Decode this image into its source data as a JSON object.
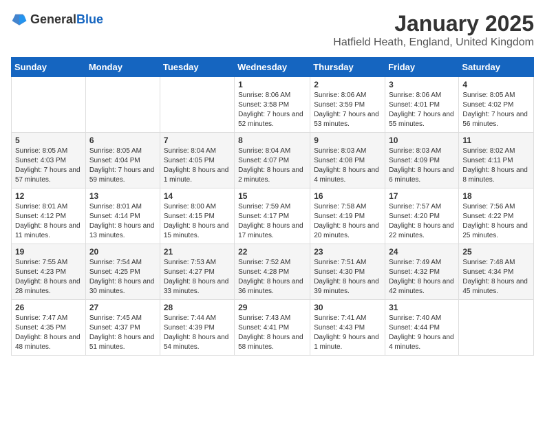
{
  "header": {
    "logo_general": "General",
    "logo_blue": "Blue",
    "title": "January 2025",
    "subtitle": "Hatfield Heath, England, United Kingdom"
  },
  "weekdays": [
    "Sunday",
    "Monday",
    "Tuesday",
    "Wednesday",
    "Thursday",
    "Friday",
    "Saturday"
  ],
  "weeks": [
    [
      {
        "day": "",
        "info": ""
      },
      {
        "day": "",
        "info": ""
      },
      {
        "day": "",
        "info": ""
      },
      {
        "day": "1",
        "info": "Sunrise: 8:06 AM\nSunset: 3:58 PM\nDaylight: 7 hours and 52 minutes."
      },
      {
        "day": "2",
        "info": "Sunrise: 8:06 AM\nSunset: 3:59 PM\nDaylight: 7 hours and 53 minutes."
      },
      {
        "day": "3",
        "info": "Sunrise: 8:06 AM\nSunset: 4:01 PM\nDaylight: 7 hours and 55 minutes."
      },
      {
        "day": "4",
        "info": "Sunrise: 8:05 AM\nSunset: 4:02 PM\nDaylight: 7 hours and 56 minutes."
      }
    ],
    [
      {
        "day": "5",
        "info": "Sunrise: 8:05 AM\nSunset: 4:03 PM\nDaylight: 7 hours and 57 minutes."
      },
      {
        "day": "6",
        "info": "Sunrise: 8:05 AM\nSunset: 4:04 PM\nDaylight: 7 hours and 59 minutes."
      },
      {
        "day": "7",
        "info": "Sunrise: 8:04 AM\nSunset: 4:05 PM\nDaylight: 8 hours and 1 minute."
      },
      {
        "day": "8",
        "info": "Sunrise: 8:04 AM\nSunset: 4:07 PM\nDaylight: 8 hours and 2 minutes."
      },
      {
        "day": "9",
        "info": "Sunrise: 8:03 AM\nSunset: 4:08 PM\nDaylight: 8 hours and 4 minutes."
      },
      {
        "day": "10",
        "info": "Sunrise: 8:03 AM\nSunset: 4:09 PM\nDaylight: 8 hours and 6 minutes."
      },
      {
        "day": "11",
        "info": "Sunrise: 8:02 AM\nSunset: 4:11 PM\nDaylight: 8 hours and 8 minutes."
      }
    ],
    [
      {
        "day": "12",
        "info": "Sunrise: 8:01 AM\nSunset: 4:12 PM\nDaylight: 8 hours and 11 minutes."
      },
      {
        "day": "13",
        "info": "Sunrise: 8:01 AM\nSunset: 4:14 PM\nDaylight: 8 hours and 13 minutes."
      },
      {
        "day": "14",
        "info": "Sunrise: 8:00 AM\nSunset: 4:15 PM\nDaylight: 8 hours and 15 minutes."
      },
      {
        "day": "15",
        "info": "Sunrise: 7:59 AM\nSunset: 4:17 PM\nDaylight: 8 hours and 17 minutes."
      },
      {
        "day": "16",
        "info": "Sunrise: 7:58 AM\nSunset: 4:19 PM\nDaylight: 8 hours and 20 minutes."
      },
      {
        "day": "17",
        "info": "Sunrise: 7:57 AM\nSunset: 4:20 PM\nDaylight: 8 hours and 22 minutes."
      },
      {
        "day": "18",
        "info": "Sunrise: 7:56 AM\nSunset: 4:22 PM\nDaylight: 8 hours and 25 minutes."
      }
    ],
    [
      {
        "day": "19",
        "info": "Sunrise: 7:55 AM\nSunset: 4:23 PM\nDaylight: 8 hours and 28 minutes."
      },
      {
        "day": "20",
        "info": "Sunrise: 7:54 AM\nSunset: 4:25 PM\nDaylight: 8 hours and 30 minutes."
      },
      {
        "day": "21",
        "info": "Sunrise: 7:53 AM\nSunset: 4:27 PM\nDaylight: 8 hours and 33 minutes."
      },
      {
        "day": "22",
        "info": "Sunrise: 7:52 AM\nSunset: 4:28 PM\nDaylight: 8 hours and 36 minutes."
      },
      {
        "day": "23",
        "info": "Sunrise: 7:51 AM\nSunset: 4:30 PM\nDaylight: 8 hours and 39 minutes."
      },
      {
        "day": "24",
        "info": "Sunrise: 7:49 AM\nSunset: 4:32 PM\nDaylight: 8 hours and 42 minutes."
      },
      {
        "day": "25",
        "info": "Sunrise: 7:48 AM\nSunset: 4:34 PM\nDaylight: 8 hours and 45 minutes."
      }
    ],
    [
      {
        "day": "26",
        "info": "Sunrise: 7:47 AM\nSunset: 4:35 PM\nDaylight: 8 hours and 48 minutes."
      },
      {
        "day": "27",
        "info": "Sunrise: 7:45 AM\nSunset: 4:37 PM\nDaylight: 8 hours and 51 minutes."
      },
      {
        "day": "28",
        "info": "Sunrise: 7:44 AM\nSunset: 4:39 PM\nDaylight: 8 hours and 54 minutes."
      },
      {
        "day": "29",
        "info": "Sunrise: 7:43 AM\nSunset: 4:41 PM\nDaylight: 8 hours and 58 minutes."
      },
      {
        "day": "30",
        "info": "Sunrise: 7:41 AM\nSunset: 4:43 PM\nDaylight: 9 hours and 1 minute."
      },
      {
        "day": "31",
        "info": "Sunrise: 7:40 AM\nSunset: 4:44 PM\nDaylight: 9 hours and 4 minutes."
      },
      {
        "day": "",
        "info": ""
      }
    ]
  ]
}
